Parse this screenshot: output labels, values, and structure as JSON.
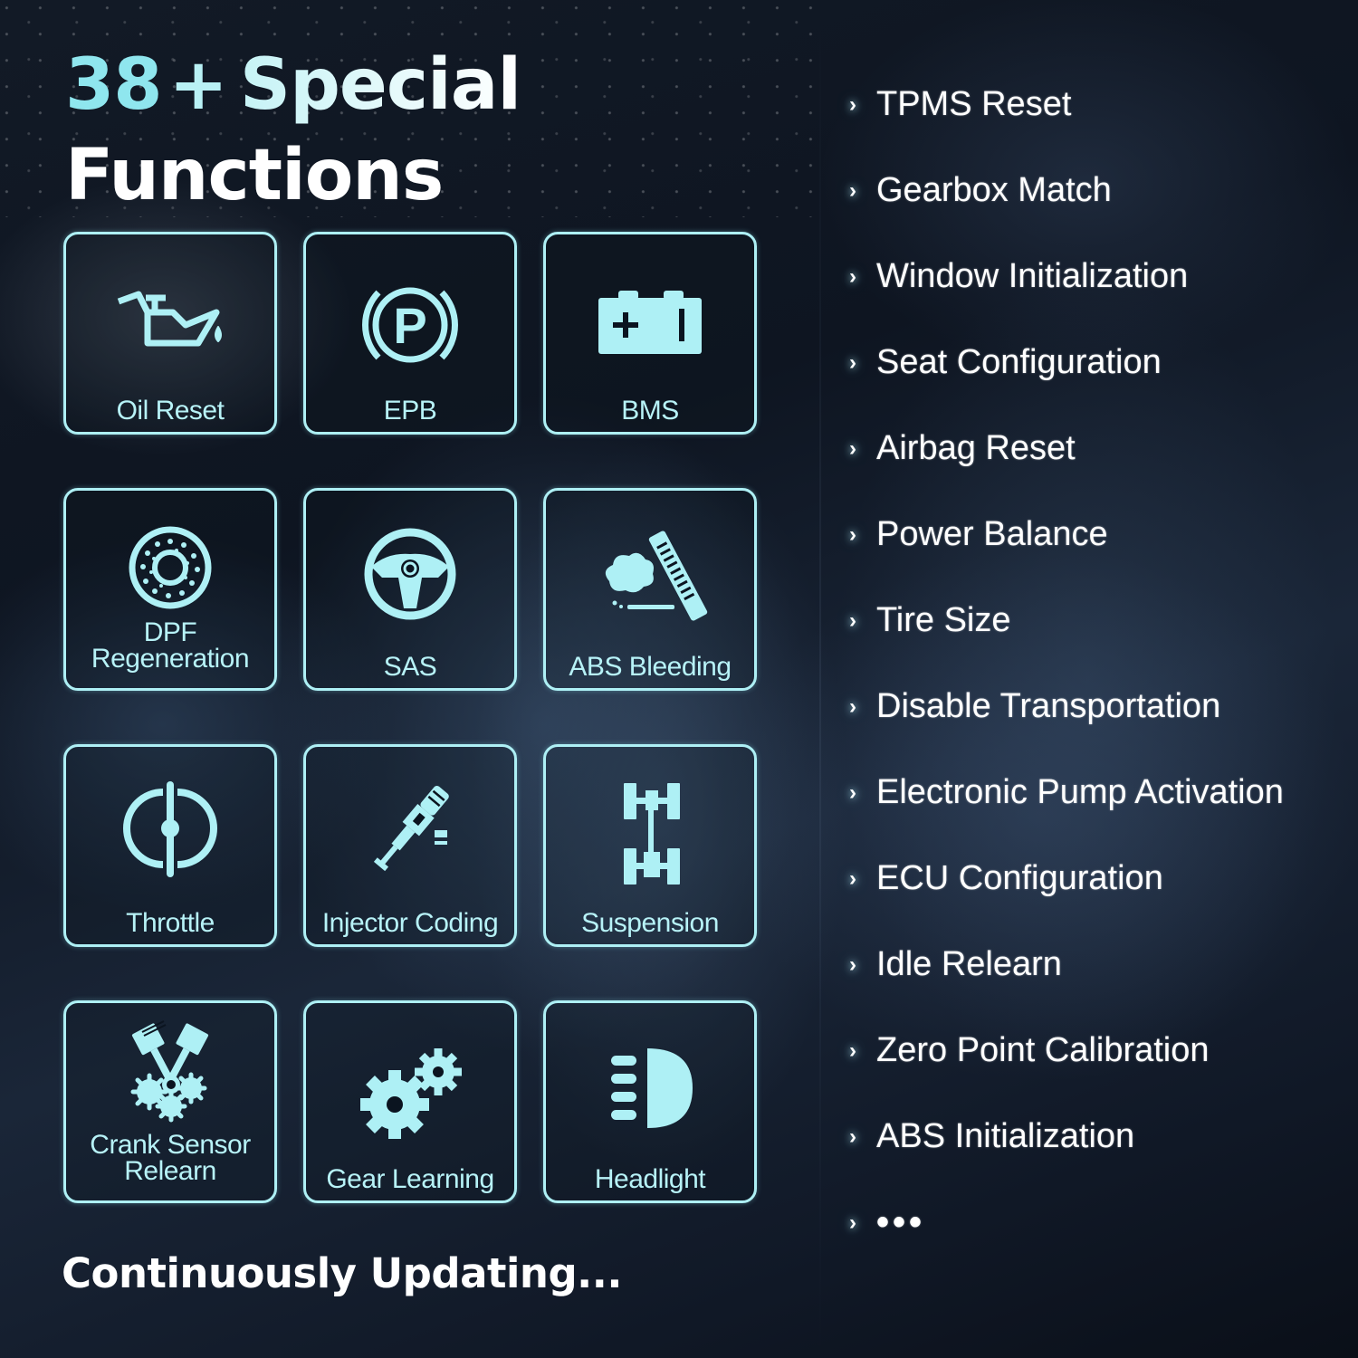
{
  "header": {
    "count": "38",
    "plus": "+",
    "title_word1": "Special",
    "title_word2": "Functions"
  },
  "theme": {
    "accent": "#aef0f5",
    "accent_text": "#b7f2f7",
    "headline_cyan": "#8fe6ee",
    "background": "#0e1521"
  },
  "cards": [
    {
      "label": "Oil Reset",
      "icon": "oil-can-icon"
    },
    {
      "label": "EPB",
      "icon": "parking-brake-icon"
    },
    {
      "label": "BMS",
      "icon": "battery-icon"
    },
    {
      "label": "DPF\nRegeneration",
      "label_line1": "DPF",
      "label_line2": "Regeneration",
      "icon": "dpf-filter-icon"
    },
    {
      "label": "SAS",
      "icon": "steering-wheel-icon"
    },
    {
      "label": "ABS Bleeding",
      "icon": "brake-bleeding-icon"
    },
    {
      "label": "Throttle",
      "icon": "throttle-icon"
    },
    {
      "label": "Injector Coding",
      "icon": "injector-icon"
    },
    {
      "label": "Suspension",
      "icon": "suspension-axle-icon"
    },
    {
      "label": "Crank Sensor\nRelearn",
      "label_line1": "Crank Sensor",
      "label_line2": "Relearn",
      "icon": "pistons-gears-icon"
    },
    {
      "label": "Gear Learning",
      "icon": "gears-icon"
    },
    {
      "label": "Headlight",
      "icon": "headlight-icon"
    }
  ],
  "functions_list": {
    "chevron": "›",
    "items": [
      "TPMS Reset",
      "Gearbox Match",
      "Window Initialization",
      "Seat Configuration",
      "Airbag Reset",
      "Power Balance",
      "Tire Size",
      "Disable Transportation",
      "Electronic Pump Activation",
      "ECU Configuration",
      "Idle Relearn",
      "Zero Point Calibration",
      "ABS Initialization"
    ],
    "more": "•••"
  },
  "footer": {
    "text": "Continuously Updating..."
  }
}
